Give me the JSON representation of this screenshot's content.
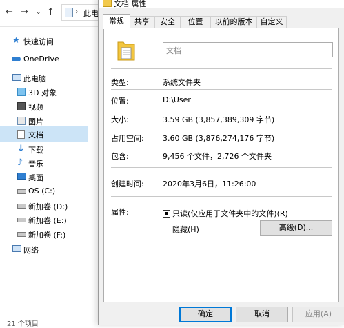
{
  "explorer": {
    "breadcrumb": "此电",
    "status": "21 个项目",
    "sidebar": [
      {
        "label": "快速访问",
        "icon": "star-icon"
      },
      {
        "label": "OneDrive",
        "icon": "cloud-icon"
      },
      {
        "label": "此电脑",
        "icon": "computer-icon"
      },
      {
        "label": "3D 对象",
        "icon": "cube-icon"
      },
      {
        "label": "视频",
        "icon": "video-icon"
      },
      {
        "label": "图片",
        "icon": "picture-icon"
      },
      {
        "label": "文档",
        "icon": "document-icon"
      },
      {
        "label": "下载",
        "icon": "download-icon"
      },
      {
        "label": "音乐",
        "icon": "music-icon"
      },
      {
        "label": "桌面",
        "icon": "desktop-icon"
      },
      {
        "label": "OS (C:)",
        "icon": "drive-icon"
      },
      {
        "label": "新加卷 (D:)",
        "icon": "drive-icon"
      },
      {
        "label": "新加卷 (E:)",
        "icon": "drive-icon"
      },
      {
        "label": "新加卷 (F:)",
        "icon": "drive-icon"
      },
      {
        "label": "网络",
        "icon": "network-icon"
      }
    ],
    "selected_item": "文档"
  },
  "dialog": {
    "title": "文档 属性",
    "tabs": [
      "常规",
      "共享",
      "安全",
      "位置",
      "以前的版本",
      "自定义"
    ],
    "active_tab": "常规",
    "name_placeholder": "文档",
    "properties": {
      "type_label": "类型:",
      "type_value": "系统文件夹",
      "location_label": "位置:",
      "location_value": "D:\\User",
      "size_label": "大小:",
      "size_value": "3.59 GB (3,857,389,309 字节)",
      "disk_size_label": "占用空间:",
      "disk_size_value": "3.60 GB (3,876,274,176 字节)",
      "contains_label": "包含:",
      "contains_value": "9,456 个文件，2,726 个文件夹",
      "created_label": "创建时间:",
      "created_value": "2020年3月6日，11:26:00",
      "attributes_label": "属性:",
      "readonly_label": "只读(仅应用于文件夹中的文件)(R)",
      "readonly_checked": true,
      "hidden_label": "隐藏(H)",
      "hidden_checked": false,
      "advanced_label": "高级(D)..."
    },
    "buttons": {
      "ok": "确定",
      "cancel": "取消",
      "apply": "应用(A)"
    }
  }
}
